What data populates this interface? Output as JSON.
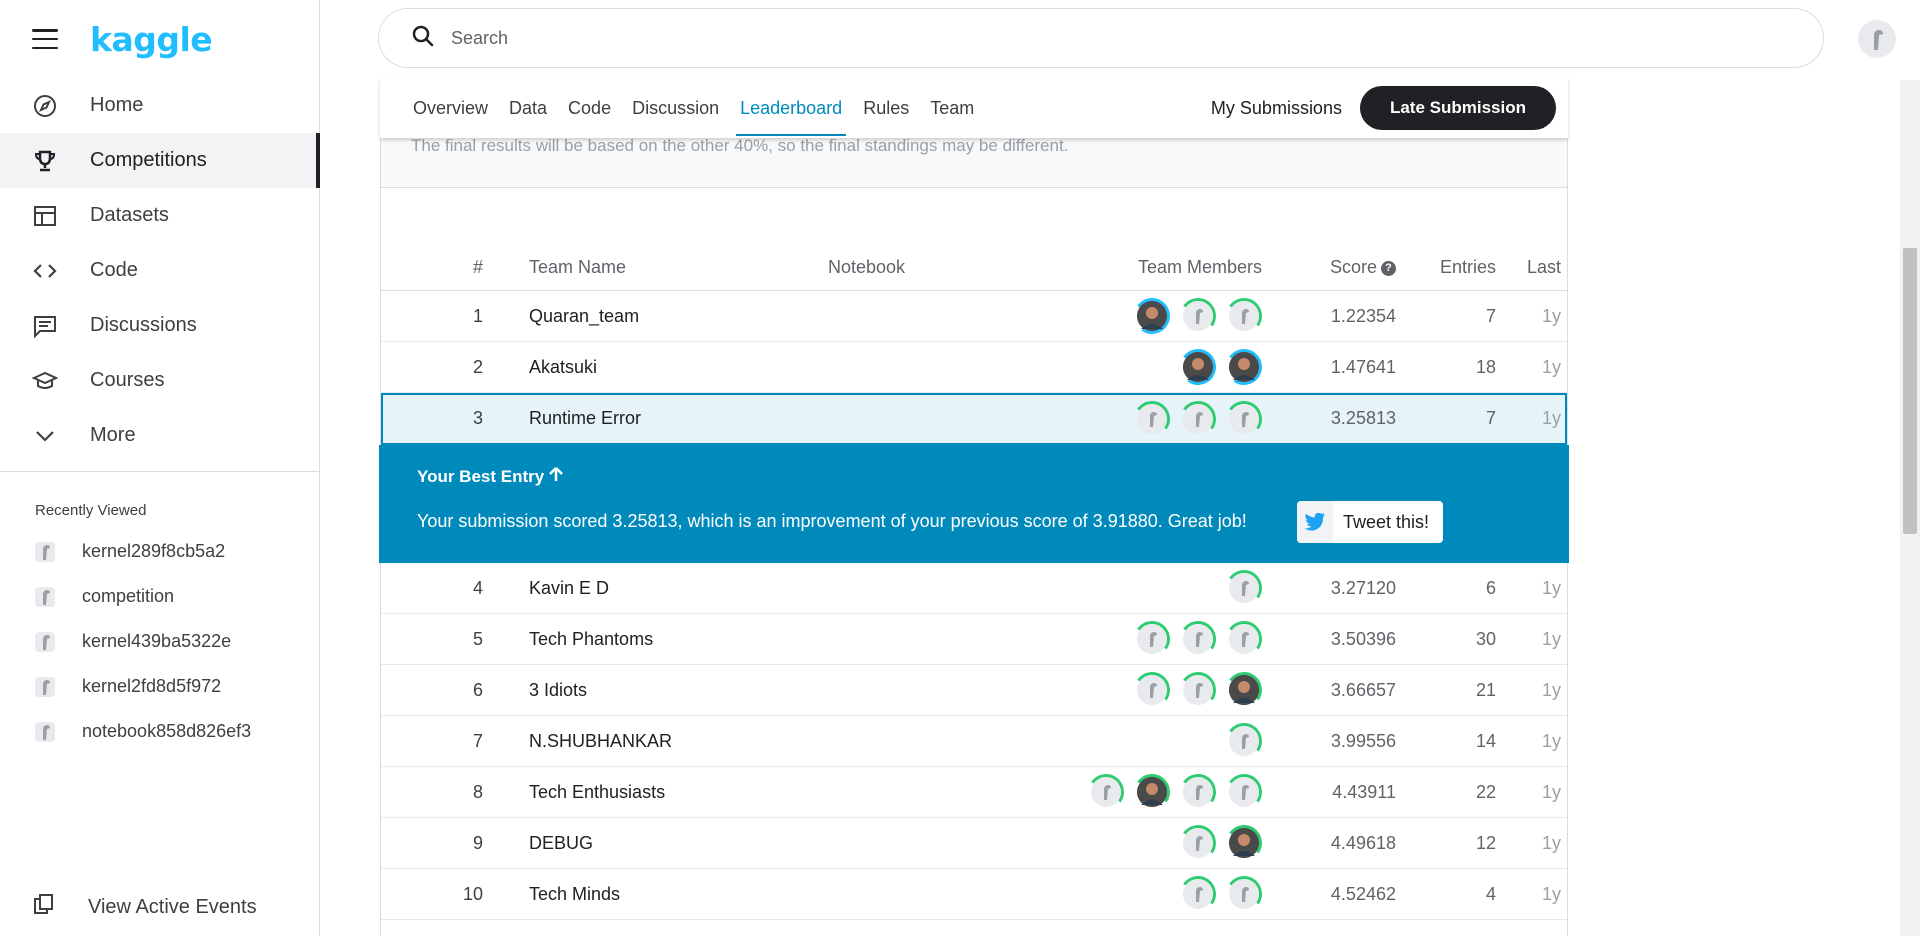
{
  "sidebar": {
    "logo": "kaggle",
    "nav": [
      {
        "label": "Home",
        "icon": "compass-icon"
      },
      {
        "label": "Competitions",
        "icon": "trophy-icon"
      },
      {
        "label": "Datasets",
        "icon": "table-icon"
      },
      {
        "label": "Code",
        "icon": "code-icon"
      },
      {
        "label": "Discussions",
        "icon": "comment-icon"
      },
      {
        "label": "Courses",
        "icon": "graduation-cap-icon"
      },
      {
        "label": "More",
        "icon": "chevron-down-icon"
      }
    ],
    "recently_viewed_title": "Recently Viewed",
    "recent": [
      "kernel289f8cb5a2",
      "competition",
      "kernel439ba5322e",
      "kernel2fd8d5f972",
      "notebook858d826ef3"
    ],
    "view_events": "View Active Events"
  },
  "header": {
    "search_placeholder": "Search"
  },
  "tabs": {
    "items": [
      "Overview",
      "Data",
      "Code",
      "Discussion",
      "Leaderboard",
      "Rules",
      "Team"
    ],
    "active": "Leaderboard",
    "my_submissions": "My Submissions",
    "late_submission": "Late Submission"
  },
  "notice": "The final results will be based on the other 40%, so the final standings may be different.",
  "leaderboard": {
    "columns": {
      "rank": "#",
      "team": "Team Name",
      "notebook": "Notebook",
      "members": "Team Members",
      "score": "Score",
      "entries": "Entries",
      "last": "Last"
    },
    "rows": [
      {
        "rank": "1",
        "team": "Quaran_team",
        "score": "1.22354",
        "entries": "7",
        "last": "1y",
        "members": [
          "photo-blue",
          "grey-green",
          "grey-green"
        ]
      },
      {
        "rank": "2",
        "team": "Akatsuki",
        "score": "1.47641",
        "entries": "18",
        "last": "1y",
        "members": [
          "photo-blue",
          "photo-blue"
        ]
      },
      {
        "rank": "3",
        "team": "Runtime Error",
        "score": "3.25813",
        "entries": "7",
        "last": "1y",
        "members": [
          "grey-green",
          "grey-green",
          "grey-green"
        ]
      },
      {
        "rank": "4",
        "team": "Kavin E D",
        "score": "3.27120",
        "entries": "6",
        "last": "1y",
        "members": [
          "grey-green"
        ]
      },
      {
        "rank": "5",
        "team": "Tech Phantoms",
        "score": "3.50396",
        "entries": "30",
        "last": "1y",
        "members": [
          "grey-green",
          "grey-green",
          "grey-green"
        ]
      },
      {
        "rank": "6",
        "team": "3 Idiots",
        "score": "3.66657",
        "entries": "21",
        "last": "1y",
        "members": [
          "grey-green",
          "grey-green",
          "photo-green"
        ]
      },
      {
        "rank": "7",
        "team": "N.SHUBHANKAR",
        "score": "3.99556",
        "entries": "14",
        "last": "1y",
        "members": [
          "grey-green"
        ]
      },
      {
        "rank": "8",
        "team": "Tech Enthusiasts",
        "score": "4.43911",
        "entries": "22",
        "last": "1y",
        "members": [
          "grey-green",
          "photo-green",
          "grey-green",
          "grey-green"
        ]
      },
      {
        "rank": "9",
        "team": "DEBUG",
        "score": "4.49618",
        "entries": "12",
        "last": "1y",
        "members": [
          "grey-green",
          "photo-green"
        ]
      },
      {
        "rank": "10",
        "team": "Tech Minds",
        "score": "4.52462",
        "entries": "4",
        "last": "1y",
        "members": [
          "grey-green",
          "grey-green"
        ]
      }
    ],
    "highlight_rank": "3",
    "best_entry": {
      "title": "Your Best Entry",
      "message": "Your submission scored 3.25813, which is an improvement of your previous score of 3.91880. Great job!",
      "tweet": "Tweet this!"
    }
  },
  "colors": {
    "accent": "#008abc",
    "logo": "#20beff",
    "ring_green": "#2ecc71",
    "ring_blue": "#20beff"
  }
}
